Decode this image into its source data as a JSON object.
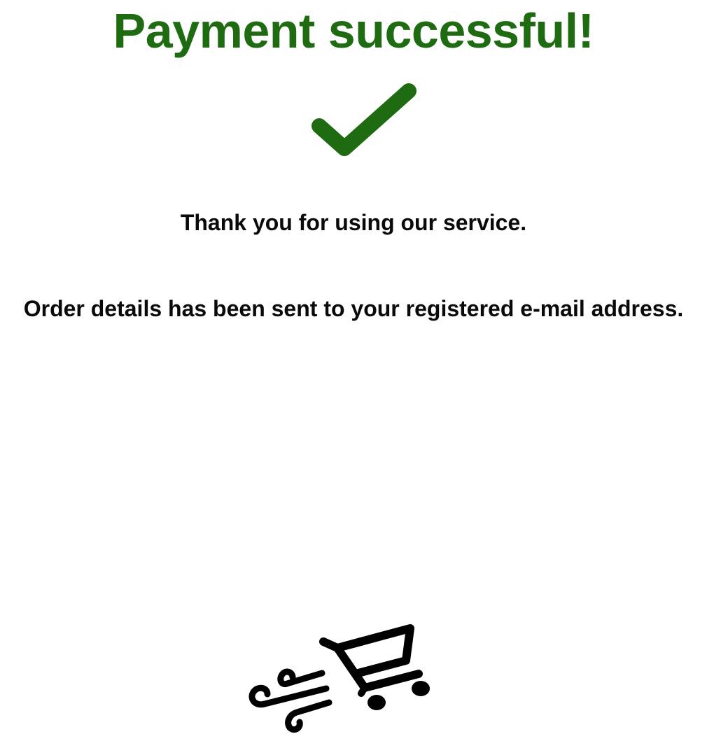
{
  "header": {
    "title": "Payment successful!",
    "accent_color": "#1e6b12"
  },
  "status_icon": "checkmark-icon",
  "messages": {
    "thanks": "Thank you for using our service.",
    "details": "Order details has been sent to your registered e-mail address."
  },
  "footer_icon": "fast-shopping-cart-icon"
}
